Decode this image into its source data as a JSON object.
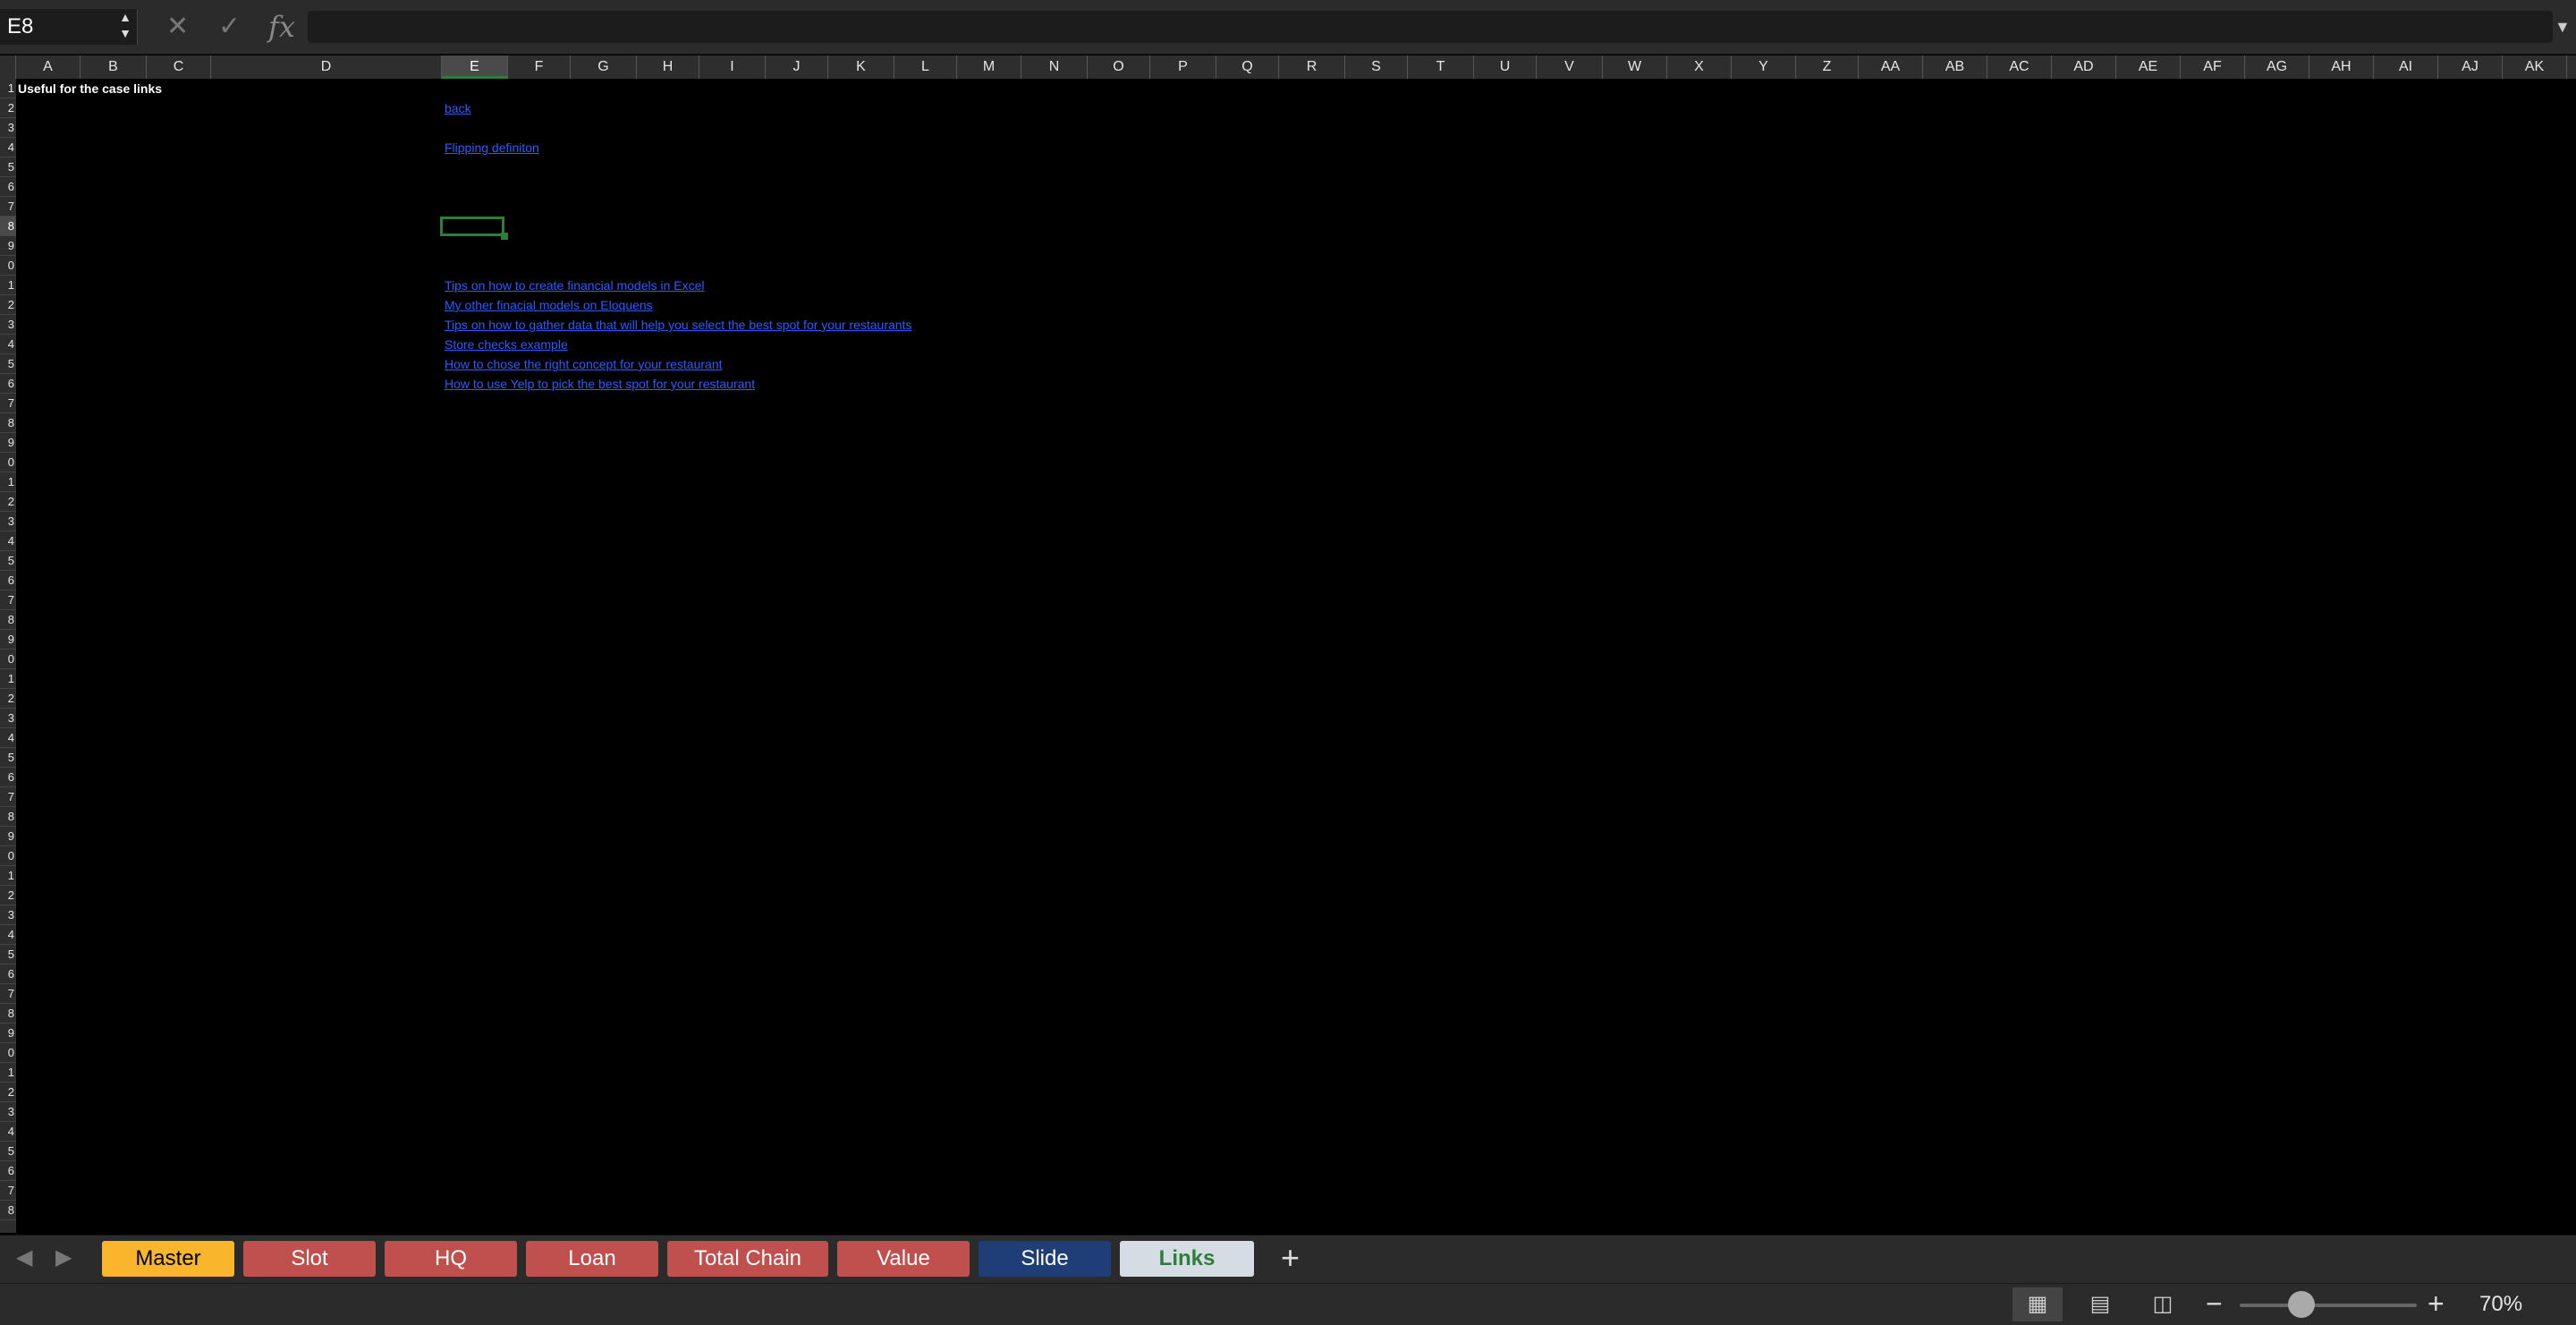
{
  "formula_bar": {
    "name_box": "E8",
    "formula": ""
  },
  "columns": [
    "A",
    "B",
    "C",
    "D",
    "E",
    "F",
    "G",
    "H",
    "I",
    "J",
    "K",
    "L",
    "M",
    "N",
    "O",
    "P",
    "Q",
    "R",
    "S",
    "T",
    "U",
    "V",
    "W",
    "X",
    "Y",
    "Z",
    "AA",
    "AB",
    "AC",
    "AD",
    "AE",
    "AF",
    "AG",
    "AH",
    "AI",
    "AJ",
    "AK"
  ],
  "active_column": "E",
  "rows_visible": 58,
  "active_row": 8,
  "cells": {
    "a1": "Useful for the case links",
    "e2": "back",
    "e4": "Flipping definiton",
    "e11": "Tips on how to create financial models in Excel",
    "e12": "My other finacial models on Eloquens",
    "e13": "Tips on how to gather data that will help you select the best spot for your restaurants",
    "e14": "Store checks example",
    "e15": "How to chose the right concept for your restaurant",
    "e16": "How to use Yelp to pick the best spot for your restaurant"
  },
  "sheet_tabs": [
    {
      "label": "Master",
      "color": "#f9b52b",
      "text_color": "#000000"
    },
    {
      "label": "Slot",
      "color": "#c0504d",
      "text_color": "#ffffff"
    },
    {
      "label": "HQ",
      "color": "#c0504d",
      "text_color": "#ffffff"
    },
    {
      "label": "Loan",
      "color": "#c0504d",
      "text_color": "#ffffff"
    },
    {
      "label": "Total Chain",
      "color": "#c0504d",
      "text_color": "#ffffff"
    },
    {
      "label": "Value",
      "color": "#c0504d",
      "text_color": "#ffffff"
    },
    {
      "label": "Slide",
      "color": "#1f3e78",
      "text_color": "#ffffff"
    },
    {
      "label": "Links",
      "color": "#d6dce4",
      "text_color": "#2f7d3a",
      "active": true
    }
  ],
  "status_bar": {
    "zoom": "70%"
  },
  "icons": {
    "stepper": "stepper-icon",
    "cancel": "x-icon",
    "enter": "check-icon",
    "fx": "fx-icon",
    "prev": "chevron-left-icon",
    "next": "chevron-right-icon",
    "add": "plus-icon",
    "normal_view": "grid-icon",
    "page_layout": "page-icon",
    "page_break": "page-break-icon"
  }
}
